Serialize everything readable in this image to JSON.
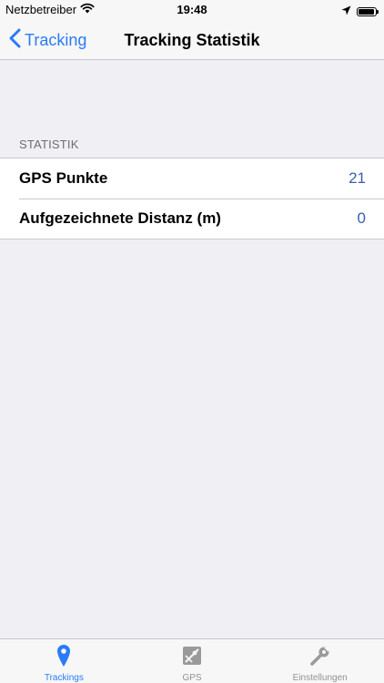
{
  "status_bar": {
    "carrier": "Netzbetreiber",
    "time": "19:48",
    "battery_percent": 95
  },
  "nav": {
    "back_label": "Tracking",
    "title": "Tracking Statistik"
  },
  "section": {
    "header": "STATISTIK",
    "rows": [
      {
        "label": "GPS Punkte",
        "value": "21"
      },
      {
        "label": "Aufgezeichnete Distanz (m)",
        "value": "0"
      }
    ]
  },
  "tab_bar": {
    "tabs": [
      {
        "label": "Trackings",
        "icon": "map-pin-icon",
        "active": true
      },
      {
        "label": "GPS",
        "icon": "map-icon",
        "active": false
      },
      {
        "label": "Einstellungen",
        "icon": "wrench-icon",
        "active": false
      }
    ]
  },
  "colors": {
    "accent": "#2a7bf6",
    "background": "#efeff4",
    "value_text": "#3a5ea8",
    "inactive_tab": "#929292"
  }
}
